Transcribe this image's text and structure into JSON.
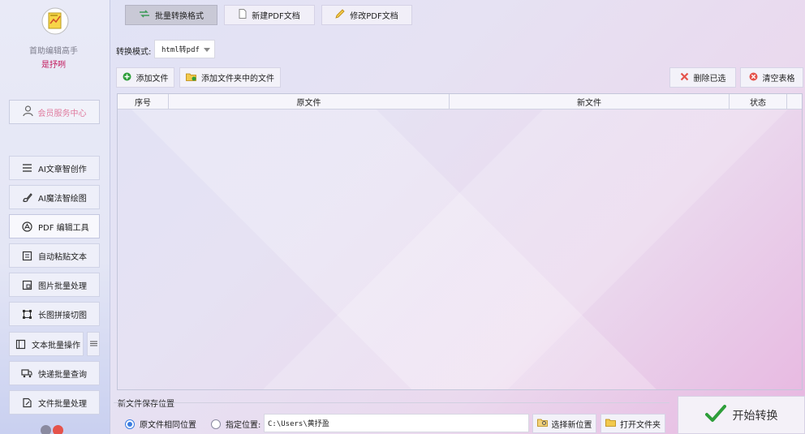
{
  "sidebar": {
    "app_name": "首助编辑高手",
    "user_name": "是抒咧",
    "member_center": "会员服务中心",
    "items": [
      {
        "label": "AI文章智创作",
        "icon": "lines-icon"
      },
      {
        "label": "AI魔法智绘图",
        "icon": "brush-icon"
      },
      {
        "label": "PDF 编辑工具",
        "icon": "pdf-icon"
      },
      {
        "label": "自动粘贴文本",
        "icon": "paste-icon"
      },
      {
        "label": "图片批量处理",
        "icon": "image-icon"
      },
      {
        "label": "长图拼接切图",
        "icon": "crop-icon"
      },
      {
        "label": "文本批量操作",
        "icon": "text-icon"
      },
      {
        "label": "快递批量查询",
        "icon": "truck-icon"
      },
      {
        "label": "文件批量处理",
        "icon": "file-edit-icon"
      }
    ]
  },
  "tabs": [
    {
      "label": "批量转换格式",
      "icon": "convert-icon"
    },
    {
      "label": "新建PDF文档",
      "icon": "document-icon"
    },
    {
      "label": "修改PDF文档",
      "icon": "pencil-icon"
    }
  ],
  "mode": {
    "label": "转换模式:",
    "value": "html转pdf"
  },
  "toolbar": {
    "add_file": "添加文件",
    "add_folder": "添加文件夹中的文件",
    "delete_selected": "删除已选",
    "clear_table": "清空表格"
  },
  "table": {
    "columns": [
      "序号",
      "原文件",
      "新文件",
      "状态"
    ]
  },
  "save": {
    "section_label": "新文件保存位置",
    "option_same": "原文件相同位置",
    "option_custom": "指定位置:",
    "path": "C:\\Users\\黄抒盈",
    "choose_btn": "选择新位置",
    "open_btn": "打开文件夹"
  },
  "start_btn": "开始转换",
  "colors": {
    "accent": "#c2185b",
    "radio_on": "#3a7be0",
    "check_green": "#2e9e3a",
    "delete_red": "#e5534b"
  }
}
